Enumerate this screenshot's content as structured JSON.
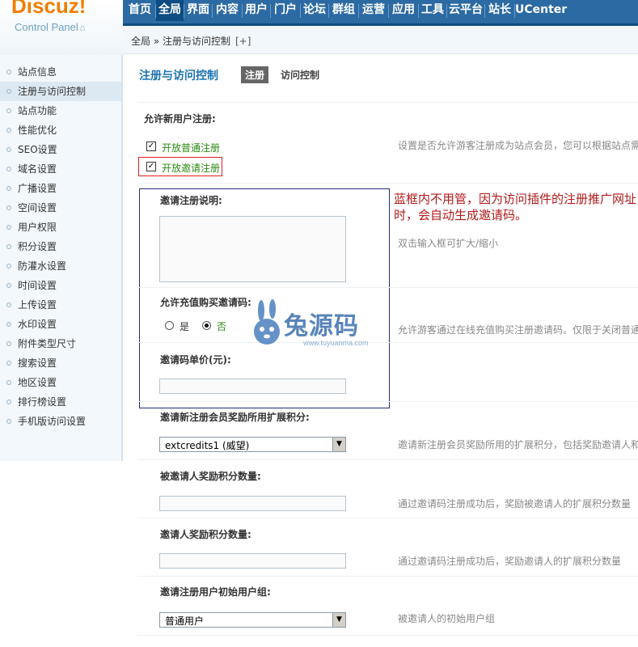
{
  "logo": {
    "brand": "Discuz!",
    "subtitle": "Control Panel",
    "watermark_brand": "兔源码",
    "watermark_url": "www.tuyuanma.com"
  },
  "topnav": [
    {
      "label": "首页"
    },
    {
      "label": "全局",
      "active": true
    },
    {
      "label": "界面"
    },
    {
      "label": "内容"
    },
    {
      "label": "用户"
    },
    {
      "label": "门户"
    },
    {
      "label": "论坛"
    },
    {
      "label": "群组"
    },
    {
      "label": "运营"
    },
    {
      "label": "应用"
    },
    {
      "label": "工具"
    },
    {
      "label": "云平台"
    },
    {
      "label": "站长"
    },
    {
      "label": "UCenter"
    }
  ],
  "breadcrumb": {
    "text": "全局 » 注册与访问控制",
    "add": "[+]"
  },
  "sidebar": {
    "items": [
      {
        "label": "站点信息"
      },
      {
        "label": "注册与访问控制",
        "active": true
      },
      {
        "label": "站点功能"
      },
      {
        "label": "性能优化"
      },
      {
        "label": "SEO设置"
      },
      {
        "label": "域名设置"
      },
      {
        "label": "广播设置"
      },
      {
        "label": "空间设置"
      },
      {
        "label": "用户权限"
      },
      {
        "label": "积分设置"
      },
      {
        "label": "防灌水设置"
      },
      {
        "label": "时间设置"
      },
      {
        "label": "上传设置"
      },
      {
        "label": "水印设置"
      },
      {
        "label": "附件类型尺寸"
      },
      {
        "label": "搜索设置"
      },
      {
        "label": "地区设置"
      },
      {
        "label": "排行榜设置"
      },
      {
        "label": "手机版访问设置"
      }
    ]
  },
  "page": {
    "title": "注册与访问控制",
    "tab_active": "注册",
    "tab_other": "访问控制"
  },
  "form": {
    "allow_register_label": "允许新用户注册:",
    "open_normal": "开放普通注册",
    "open_invite": "开放邀请注册",
    "allow_register_tip": "设置是否允许游客注册成为站点会员，您可以根据站点需",
    "invite_desc_label": "邀请注册说明:",
    "textarea_tip": "双击输入框可扩大/缩小",
    "buy_invite_label": "允许充值购买邀请码:",
    "radio_yes": "是",
    "radio_no": "否",
    "buy_invite_value": "否",
    "buy_invite_tip": "允许游客通过在线充值购买注册邀请码。仅限于关闭普通",
    "invite_price_label": "邀请码单价(元):",
    "invite_price_value": "",
    "reward_ext_label": "邀请新注册会员奖励所用扩展积分:",
    "reward_ext_value": "extcredits1 (威望)",
    "reward_ext_tip": "邀请新注册会员奖励所用的扩展积分，包括奖励邀请人和",
    "invitee_reward_label": "被邀请人奖励积分数量:",
    "invitee_reward_value": "",
    "invitee_reward_tip": "通过邀请码注册成功后，奖励被邀请人的扩展积分数量",
    "inviter_reward_label": "邀请人奖励积分数量:",
    "inviter_reward_value": "",
    "inviter_reward_tip": "通过邀请码注册成功后，奖励邀请人的扩展积分数量",
    "init_group_label": "邀请注册用户初始用户组:",
    "init_group_value": "普通用户",
    "init_group_tip": "被邀请人的初始用户组"
  },
  "annotation": "蓝框内不用管，因为访问插件的注册推广网址时，会自动生成邀请码。"
}
